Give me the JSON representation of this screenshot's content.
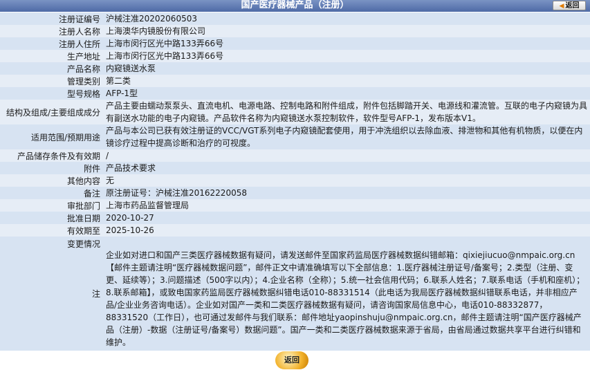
{
  "header": {
    "title": "国产医疗器械产品（注册）",
    "back_label": "返回"
  },
  "fields": [
    {
      "label": "注册证编号",
      "value": "沪械注准20202060503"
    },
    {
      "label": "注册人名称",
      "value": "上海澳华内镜股份有限公司"
    },
    {
      "label": "注册人住所",
      "value": "上海市闵行区光中路133弄66号"
    },
    {
      "label": "生产地址",
      "value": "上海市闵行区光中路133弄66号"
    },
    {
      "label": "产品名称",
      "value": "内窥镜送水泵"
    },
    {
      "label": "管理类别",
      "value": "第二类"
    },
    {
      "label": "型号规格",
      "value": "AFP-1型"
    },
    {
      "label": "结构及组成/主要组成成分",
      "value": "产品主要由蠕动泵泵头、直流电机、电源电路、控制电路和附件组成，附件包括脚踏开关、电源线和灌流管。互联的电子内窥镜为具有副送水功能的电子内窥镜。产品软件名称为内窥镜送水泵控制软件，软件型号AFP-1，发布版本V1。"
    },
    {
      "label": "适用范围/预期用途",
      "value": "产品与本公司已获有效注册证的VCC/VGT系列电子内窥镜配套使用，用于冲洗组织以去除血液、排泄物和其他有机物质，以便在内镜诊疗过程中提高诊断和治疗的可视度。"
    },
    {
      "label": "产品储存条件及有效期",
      "value": "/"
    },
    {
      "label": "附件",
      "value": "产品技术要求"
    },
    {
      "label": "其他内容",
      "value": "无"
    },
    {
      "label": "备注",
      "value": "原注册证号：沪械注准20162220058"
    },
    {
      "label": "审批部门",
      "value": "上海市药品监督管理局"
    },
    {
      "label": "批准日期",
      "value": "2020-10-27"
    },
    {
      "label": "有效期至",
      "value": "2025-10-26"
    },
    {
      "label": "变更情况",
      "value": ""
    }
  ],
  "note": {
    "label": "注",
    "text": "企业如对进口和国产三类医疗器械数据有疑问，请发送邮件至国家药监局医疗器械数据纠错邮箱：qixiejiucuo@nmpaic.org.cn【邮件主题请注明“医疗器械数据问题”，邮件正文中请准确填写以下全部信息：1.医疗器械注册证号/备案号；2.类型（注册、变更、延续等）；3.问题描述（500字以内）；4.企业名称（全称）；5.统一社会信用代码；6.联系人姓名；7.联系电话（手机和座机）；8.联系邮箱】，或致电国家药监局医疗器械数据纠错电话010-88331514（此电话为我局医疗器械数据纠错联系电话，并非相应产品/企业业务咨询电话）。企业如对国产一类和二类医疗器械数据有疑问，请咨询国家局信息中心，电话010-88332877，88331520（工作日），也可通过发邮件与我们联系：邮件地址yaopinshuju@nmpaic.org.cn，邮件主题请注明“国产医疗器械产品（注册）-数据（注册证号/备案号）数据问题”。国产一类和二类医疗器械数据来源于省局，由省局通过数据共享平台进行纠错和维护。"
  },
  "footer": {
    "back_label": "返回"
  }
}
